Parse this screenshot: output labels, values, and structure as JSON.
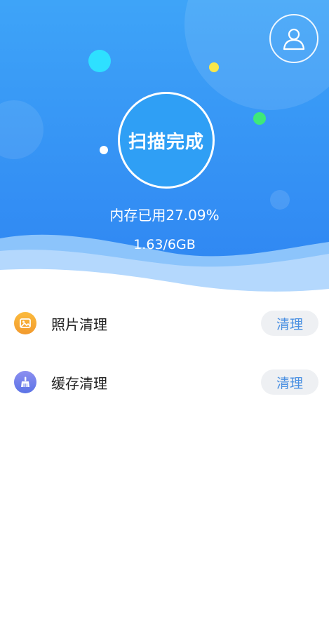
{
  "scan": {
    "status_label": "扫描完成",
    "memory_usage_text": "内存已用27.09%",
    "memory_size_text": "1.63/6GB"
  },
  "header": {
    "profile_icon": "user-icon",
    "gradient_colors": [
      "#3aa0f7",
      "#2f86f2"
    ]
  },
  "list": {
    "items": [
      {
        "label": "照片清理",
        "button_label": "清理",
        "icon": "photo-icon",
        "icon_color": "#f7a534"
      },
      {
        "label": "缓存清理",
        "button_label": "清理",
        "icon": "broom-icon",
        "icon_color": "#6b7fe8"
      }
    ]
  },
  "colors": {
    "accent": "#4a90e2",
    "button_bg": "#eef0f3"
  }
}
